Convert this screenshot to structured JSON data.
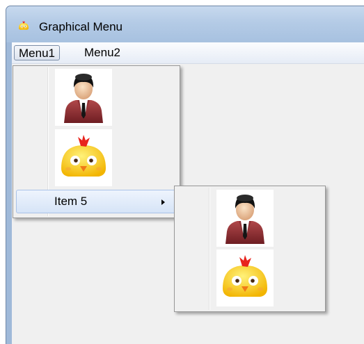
{
  "window": {
    "title": "Graphical Menu",
    "icon": "chick-icon"
  },
  "menubar": {
    "items": [
      {
        "label": "Menu1"
      },
      {
        "label": "Menu2"
      }
    ]
  },
  "menu1": {
    "items": [
      {
        "type": "image",
        "icon": "businessman-icon"
      },
      {
        "type": "image",
        "icon": "chick-icon"
      },
      {
        "type": "submenu",
        "label": "Item 5"
      }
    ]
  },
  "submenu": {
    "items": [
      {
        "type": "image",
        "icon": "businessman-icon"
      },
      {
        "type": "image",
        "icon": "chick-icon"
      }
    ]
  }
}
